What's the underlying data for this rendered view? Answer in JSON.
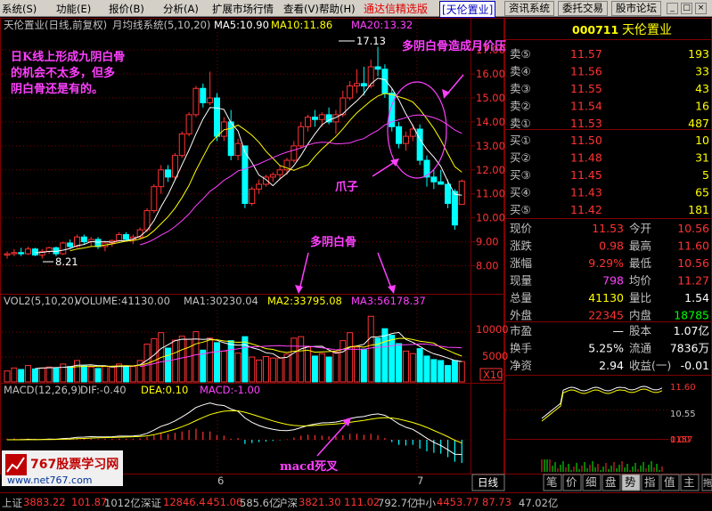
{
  "menubar": {
    "items": [
      "系统(S)",
      "功能(E)",
      "报价(B)",
      "分析(A)",
      "扩展市场行情",
      "查看(V)",
      "帮助(H)"
    ],
    "app_title": "通达信精选版",
    "security_title": "[天伦置业]",
    "buttons": [
      "资讯系统",
      "委托交易",
      "股市论坛"
    ],
    "window_controls": [
      "_",
      "□",
      "×"
    ]
  },
  "chart_header": {
    "name": "天伦置业(日线,前复权)",
    "system": "月均线系统(5,10,20)",
    "ma5": "MA5:10.90",
    "ma10": "MA10:11.86",
    "ma20": "MA20:13.32"
  },
  "annotations": {
    "note1": [
      "日K线上形成九阴白骨",
      "的机会不太多，但多",
      "阴白骨还是有的。"
    ],
    "note2": "多阴白骨造成月价压",
    "note3": "爪子",
    "note4": "多阴白骨",
    "note5": "macd死叉",
    "high_label": "17.13",
    "low_label": "8.21"
  },
  "price_axis": [
    "17.00",
    "16.00",
    "15.00",
    "14.00",
    "13.00",
    "12.00",
    "11.00",
    "10.00",
    "9.00",
    "8.00"
  ],
  "volume_header": {
    "title": "VOL2(5,10,20)",
    "volume": "VOLUME:41130.00",
    "ma1": "MA1:30230.04",
    "ma2": "MA2:33795.08",
    "ma3": "MA3:56178.37"
  },
  "volume_axis": [
    "10000",
    "5000"
  ],
  "volume_unit": "X10",
  "macd_header": {
    "title": "MACD(12,26,9)",
    "dif": "DIF:-0.40",
    "dea": "DEA:0.10",
    "macd": "MACD:-1.00"
  },
  "x_axis": [
    "6",
    "7"
  ],
  "period_tab": "日线",
  "watermark": {
    "brand": "767股票学习网",
    "url": "www.net767.com"
  },
  "quote_panel": {
    "code": "000711",
    "name": "天伦置业",
    "asks": [
      {
        "label": "卖⑤",
        "price": "11.57",
        "vol": "193"
      },
      {
        "label": "卖④",
        "price": "11.56",
        "vol": "33"
      },
      {
        "label": "卖③",
        "price": "11.55",
        "vol": "43"
      },
      {
        "label": "卖②",
        "price": "11.54",
        "vol": "16"
      },
      {
        "label": "卖①",
        "price": "11.53",
        "vol": "487"
      }
    ],
    "bids": [
      {
        "label": "买①",
        "price": "11.50",
        "vol": "10"
      },
      {
        "label": "买②",
        "price": "11.48",
        "vol": "31"
      },
      {
        "label": "买③",
        "price": "11.45",
        "vol": "5"
      },
      {
        "label": "买④",
        "price": "11.43",
        "vol": "65"
      },
      {
        "label": "买⑤",
        "price": "11.42",
        "vol": "181"
      }
    ],
    "stats": [
      {
        "l1": "现价",
        "v1": "11.53",
        "l2": "今开",
        "v2": "10.56"
      },
      {
        "l1": "涨跌",
        "v1": "0.98",
        "l2": "最高",
        "v2": "11.60"
      },
      {
        "l1": "涨幅",
        "v1": "9.29%",
        "l2": "最低",
        "v2": "10.56"
      },
      {
        "l1": "现量",
        "v1": "798",
        "l2": "均价",
        "v2": "11.27"
      },
      {
        "l1": "总量",
        "v1": "41130",
        "l2": "量比",
        "v2": "1.54"
      },
      {
        "l1": "外盘",
        "v1": "22345",
        "l2": "内盘",
        "v2": "18785"
      }
    ],
    "stats2": [
      {
        "l1": "市盈",
        "v1": "—",
        "l2": "股本",
        "v2": "1.07亿"
      },
      {
        "l1": "换手",
        "v1": "5.25%",
        "l2": "流通",
        "v2": "7836万"
      },
      {
        "l1": "净资",
        "v1": "2.94",
        "l2": "收益(一)",
        "v2": "-0.01"
      }
    ],
    "mini_chart": {
      "high": "11.60",
      "mid": "10.55",
      "zero": "0.00",
      "vol": "1157"
    },
    "tabs": [
      "笔",
      "价",
      "细",
      "盘",
      "势",
      "指",
      "值",
      "主"
    ],
    "active_tab": "势",
    "tuo": "拖"
  },
  "ticker": [
    {
      "name": "上证",
      "value": "3883.22",
      "change": "101.87",
      "amount": "1012亿"
    },
    {
      "name": "深证",
      "value": "12846.4",
      "change": "451.06",
      "amount": "585.6亿"
    },
    {
      "name": "沪深",
      "value": "3821.30",
      "change": "111.02",
      "amount": "792.7亿"
    },
    {
      "name": "中小",
      "value": "4453.77",
      "change": "87.73",
      "amount": "47.02亿"
    }
  ],
  "colors": {
    "up": "#ff3232",
    "down": "#00ffff",
    "ma5": "#ffffff",
    "ma10": "#ffff00",
    "ma20": "#ff40ff",
    "grid": "#800000",
    "annotation": "#ff40ff"
  },
  "chart_data": {
    "type": "candlestick",
    "price_range": [
      7.5,
      17.6
    ],
    "candles": [
      [
        8.45,
        8.6,
        8.3,
        8.5
      ],
      [
        8.5,
        8.7,
        8.4,
        8.55
      ],
      [
        8.55,
        8.75,
        8.4,
        8.5
      ],
      [
        8.5,
        8.8,
        8.45,
        8.7
      ],
      [
        8.7,
        8.75,
        8.4,
        8.45
      ],
      [
        8.45,
        8.7,
        8.3,
        8.6
      ],
      [
        8.6,
        8.8,
        8.5,
        8.75
      ],
      [
        8.75,
        8.8,
        8.4,
        8.5
      ],
      [
        8.5,
        9.0,
        8.45,
        8.95
      ],
      [
        8.95,
        9.1,
        8.7,
        8.8
      ],
      [
        8.8,
        9.3,
        8.75,
        9.2
      ],
      [
        9.2,
        9.3,
        8.9,
        9.0
      ],
      [
        9.0,
        9.2,
        8.8,
        9.1
      ],
      [
        9.1,
        9.2,
        8.7,
        8.8
      ],
      [
        8.8,
        9.0,
        8.6,
        8.95
      ],
      [
        8.95,
        9.1,
        8.8,
        9.05
      ],
      [
        9.05,
        9.4,
        9.0,
        9.3
      ],
      [
        9.3,
        9.4,
        9.0,
        9.1
      ],
      [
        9.1,
        9.3,
        8.9,
        9.2
      ],
      [
        9.2,
        9.6,
        9.1,
        9.5
      ],
      [
        9.5,
        10.4,
        9.4,
        10.3
      ],
      [
        10.3,
        11.4,
        10.2,
        11.3
      ],
      [
        11.3,
        12.2,
        11.0,
        12.0
      ],
      [
        12.0,
        12.2,
        11.5,
        11.7
      ],
      [
        11.7,
        12.7,
        11.6,
        12.6
      ],
      [
        12.6,
        13.6,
        12.5,
        13.5
      ],
      [
        13.5,
        14.4,
        13.4,
        14.3
      ],
      [
        14.3,
        15.5,
        14.2,
        15.4
      ],
      [
        15.4,
        15.6,
        14.6,
        14.8
      ],
      [
        14.8,
        16.1,
        14.7,
        15.0
      ],
      [
        15.0,
        15.2,
        13.2,
        13.4
      ],
      [
        13.4,
        14.2,
        13.2,
        14.0
      ],
      [
        14.0,
        14.5,
        12.4,
        12.6
      ],
      [
        12.6,
        13.3,
        12.4,
        13.1
      ],
      [
        13.0,
        13.0,
        10.4,
        10.6
      ],
      [
        10.6,
        11.3,
        10.5,
        11.2
      ],
      [
        11.2,
        11.6,
        11.0,
        11.4
      ],
      [
        11.4,
        11.8,
        11.3,
        11.7
      ],
      [
        11.7,
        11.9,
        11.5,
        11.8
      ],
      [
        11.8,
        12.2,
        11.6,
        12.0
      ],
      [
        12.0,
        12.5,
        11.8,
        12.4
      ],
      [
        12.4,
        13.2,
        12.3,
        13.0
      ],
      [
        13.0,
        14.0,
        12.9,
        13.8
      ],
      [
        13.8,
        14.3,
        13.6,
        14.2
      ],
      [
        14.2,
        14.5,
        13.8,
        14.1
      ],
      [
        14.1,
        14.4,
        13.8,
        14.3
      ],
      [
        14.3,
        14.6,
        13.9,
        14.0
      ],
      [
        14.0,
        14.5,
        13.5,
        14.3
      ],
      [
        14.3,
        15.3,
        14.2,
        15.0
      ],
      [
        15.0,
        15.7,
        14.9,
        15.5
      ],
      [
        15.5,
        16.2,
        15.2,
        15.6
      ],
      [
        15.6,
        16.3,
        15.1,
        15.5
      ],
      [
        15.5,
        16.6,
        15.4,
        16.3
      ],
      [
        16.3,
        17.13,
        15.9,
        16.2
      ],
      [
        16.2,
        16.4,
        15.0,
        15.2
      ],
      [
        15.2,
        15.4,
        13.6,
        13.8
      ],
      [
        13.8,
        14.0,
        12.9,
        13.1
      ],
      [
        13.1,
        13.6,
        12.8,
        13.4
      ],
      [
        13.4,
        13.9,
        13.2,
        13.7
      ],
      [
        13.7,
        13.9,
        12.2,
        12.4
      ],
      [
        12.4,
        12.6,
        11.3,
        11.7
      ],
      [
        11.7,
        12.0,
        11.2,
        11.5
      ],
      [
        11.5,
        12.0,
        11.4,
        11.4
      ],
      [
        11.4,
        11.6,
        10.4,
        10.6
      ],
      [
        11.1,
        11.2,
        9.5,
        9.7
      ],
      [
        10.56,
        11.6,
        10.56,
        11.53
      ]
    ],
    "volumes": [
      2200,
      2800,
      2500,
      3300,
      2600,
      2800,
      3000,
      2700,
      3600,
      3100,
      4300,
      3200,
      3000,
      2700,
      3100,
      3000,
      3600,
      3200,
      3100,
      4300,
      7600,
      8700,
      9900,
      6800,
      8400,
      9200,
      8600,
      10100,
      6400,
      8800,
      7900,
      6200,
      8300,
      5800,
      9100,
      5000,
      4400,
      5100,
      4800,
      4800,
      5600,
      8800,
      9100,
      7000,
      5200,
      5700,
      5000,
      6000,
      8300,
      9900,
      7000,
      6600,
      13200,
      8800,
      10700,
      9400,
      7700,
      6200,
      5700,
      6700,
      5200,
      4500,
      4300,
      3300,
      4300,
      4100
    ],
    "macd_hist": [
      0.05,
      0.06,
      0.05,
      0.06,
      0.05,
      0.04,
      0.05,
      0.04,
      0.05,
      0.04,
      0.05,
      0.04,
      0.04,
      0.03,
      0.04,
      0.04,
      0.05,
      0.04,
      0.04,
      0.06,
      0.12,
      0.2,
      0.28,
      0.25,
      0.3,
      0.36,
      0.42,
      0.48,
      0.35,
      0.36,
      0.2,
      0.18,
      0.05,
      0.08,
      -0.18,
      -0.14,
      -0.1,
      -0.08,
      -0.05,
      -0.02,
      0.02,
      0.1,
      0.18,
      0.22,
      0.2,
      0.18,
      0.15,
      0.15,
      0.2,
      0.26,
      0.26,
      0.22,
      0.26,
      0.2,
      0.08,
      -0.1,
      -0.22,
      -0.25,
      -0.22,
      -0.38,
      -0.5,
      -0.56,
      -0.6,
      -0.75,
      -0.95,
      -1.0
    ]
  }
}
